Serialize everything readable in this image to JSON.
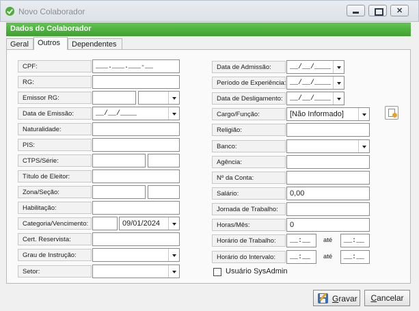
{
  "window": {
    "title": "Novo Colaborador"
  },
  "header": {
    "title": "Dados do Colaborador"
  },
  "tabs": [
    {
      "label": "Geral"
    },
    {
      "label": "Outros"
    },
    {
      "label": "Dependentes"
    }
  ],
  "left": {
    "cpf": {
      "label": "CPF:",
      "value": "___.___.___-__"
    },
    "rg": {
      "label": "RG:",
      "value": ""
    },
    "emissor_rg": {
      "label": "Emissor RG:",
      "value": "",
      "uf": ""
    },
    "data_emissao": {
      "label": "Data de Emissão:",
      "value": "__/__/____"
    },
    "naturalidade": {
      "label": "Naturalidade:",
      "value": ""
    },
    "pis": {
      "label": "PIS:",
      "value": ""
    },
    "ctps": {
      "label": "CTPS/Série:",
      "value": "",
      "serie": ""
    },
    "titulo_eleitor": {
      "label": "Título de Eleitor:",
      "value": ""
    },
    "zona_secao": {
      "label": "Zona/Seção:",
      "zona": "",
      "secao": ""
    },
    "habilitacao": {
      "label": "Habilitação:",
      "value": ""
    },
    "categoria_vencimento": {
      "label": "Categoria/Vencimento:",
      "categoria": "",
      "vencimento": "09/01/2024"
    },
    "cert_reservista": {
      "label": "Cert. Reservista:",
      "value": ""
    },
    "grau_instrucao": {
      "label": "Grau de Instrução:",
      "value": ""
    },
    "setor": {
      "label": "Setor:",
      "value": ""
    }
  },
  "right": {
    "data_admissao": {
      "label": "Data de Admissão:",
      "value": "__/__/____"
    },
    "periodo_experiencia": {
      "label": "Período de Experiência:",
      "value": "__/__/____"
    },
    "data_desligamento": {
      "label": "Data de Desligamento:",
      "value": "__/__/____"
    },
    "cargo_funcao": {
      "label": "Cargo/Função:",
      "value": "[Não Informado]"
    },
    "religiao": {
      "label": "Religião:",
      "value": ""
    },
    "banco": {
      "label": "Banco:",
      "value": ""
    },
    "agencia": {
      "label": "Agência:",
      "value": ""
    },
    "conta": {
      "label": "Nº da Conta:",
      "value": ""
    },
    "salario": {
      "label": "Salário:",
      "value": "0,00"
    },
    "jornada": {
      "label": "Jornada de Trabalho:",
      "value": ""
    },
    "horas_mes": {
      "label": "Horas/Mês:",
      "value": "0"
    },
    "horario_trabalho": {
      "label": "Horário de Trabalho:",
      "inicio": "__:__",
      "ate": "até",
      "fim": "__:__"
    },
    "horario_intervalo": {
      "label": "Horário do Intervalo:",
      "inicio": "__:__",
      "ate": "até",
      "fim": "__:__"
    },
    "usuario_sysadmin": {
      "label": "Usuário SysAdmin",
      "checked": false
    }
  },
  "buttons": {
    "save": {
      "label_first": "G",
      "label_rest": "ravar"
    },
    "cancel": {
      "label_first": "C",
      "label_rest": "ancelar"
    }
  },
  "icons": {
    "app": "check-circle-icon",
    "save": "floppy-pencil-icon",
    "new_cargo": "new-document-icon"
  },
  "colors": {
    "header_green": "#4cb23b"
  }
}
